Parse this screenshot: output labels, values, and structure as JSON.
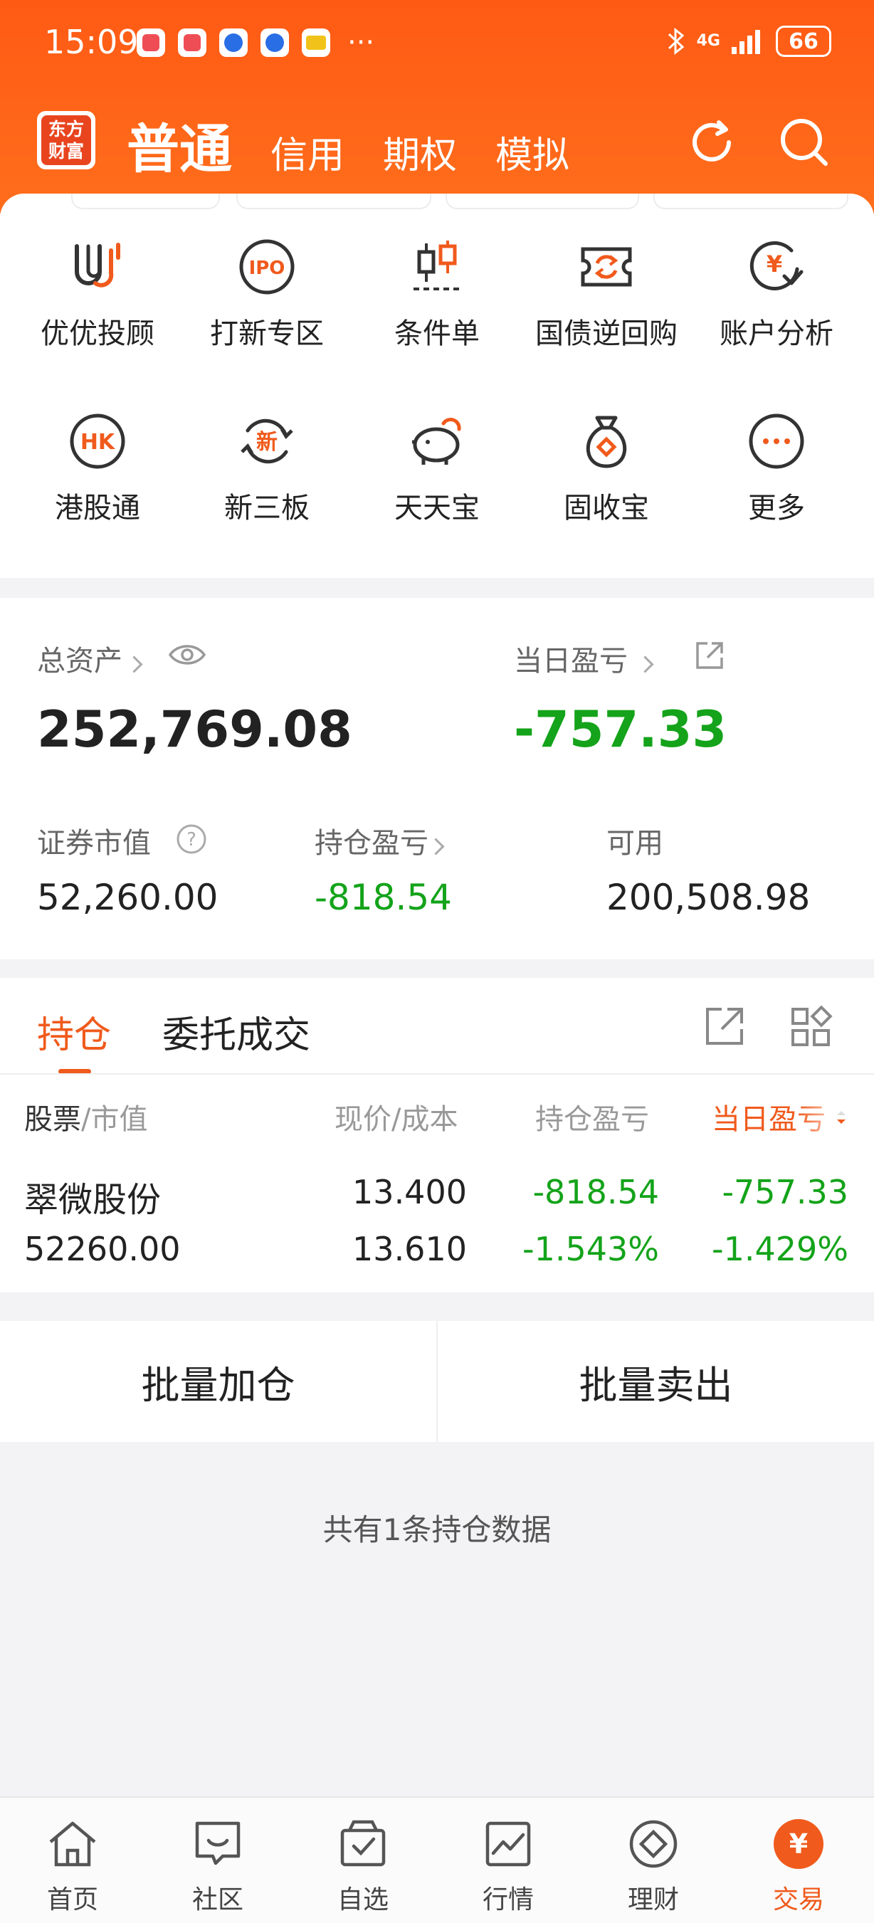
{
  "status": {
    "time": "15:09",
    "network": "4G",
    "battery": "66"
  },
  "header": {
    "logo_text_top": "东方",
    "logo_text_bottom": "财富",
    "tabs": [
      {
        "label": "普通",
        "active": true
      },
      {
        "label": "信用"
      },
      {
        "label": "期权"
      },
      {
        "label": "模拟"
      }
    ],
    "accent": "#ff5a14"
  },
  "grid": [
    {
      "label": "优优投顾",
      "icon": "uu-advisor-icon"
    },
    {
      "label": "打新专区",
      "icon": "ipo-icon"
    },
    {
      "label": "条件单",
      "icon": "candlestick-icon"
    },
    {
      "label": "国债逆回购",
      "icon": "bond-repo-icon"
    },
    {
      "label": "账户分析",
      "icon": "account-analysis-icon"
    },
    {
      "label": "港股通",
      "icon": "hk-icon"
    },
    {
      "label": "新三板",
      "icon": "new-third-board-icon"
    },
    {
      "label": "天天宝",
      "icon": "piggy-bank-icon"
    },
    {
      "label": "固收宝",
      "icon": "money-bag-icon"
    },
    {
      "label": "更多",
      "icon": "more-icon"
    }
  ],
  "assets": {
    "total_label": "总资产",
    "total_value": "252,769.08",
    "daily_pl_label": "当日盈亏",
    "daily_pl_value": "-757.33",
    "securities_label": "证券市值",
    "securities_value": "52,260.00",
    "holding_pl_label": "持仓盈亏",
    "holding_pl_value": "-818.54",
    "available_label": "可用",
    "available_value": "200,508.98",
    "loss_color": "#14a31a"
  },
  "positions": {
    "tab_holdings": "持仓",
    "tab_orders": "委托成交",
    "headers": {
      "stock": "股票",
      "stock_sub": "/市值",
      "price": "现价/成本",
      "holding_pl": "持仓盈亏",
      "daily_pl": "当日盈亏"
    },
    "rows": [
      {
        "name": "翠微股份",
        "market_value": "52260.00",
        "price": "13.400",
        "cost": "13.610",
        "holding_pl": "-818.54",
        "holding_pl_pct": "-1.543%",
        "daily_pl": "-757.33",
        "daily_pl_pct": "-1.429%"
      }
    ]
  },
  "actions": {
    "batch_add": "批量加仓",
    "batch_sell": "批量卖出"
  },
  "summary": "共有1条持仓数据",
  "bottom_nav": [
    {
      "label": "首页",
      "icon": "home-icon"
    },
    {
      "label": "社区",
      "icon": "community-icon"
    },
    {
      "label": "自选",
      "icon": "watchlist-icon"
    },
    {
      "label": "行情",
      "icon": "market-icon"
    },
    {
      "label": "理财",
      "icon": "wealth-icon"
    },
    {
      "label": "交易",
      "icon": "trade-icon",
      "active": true
    }
  ]
}
